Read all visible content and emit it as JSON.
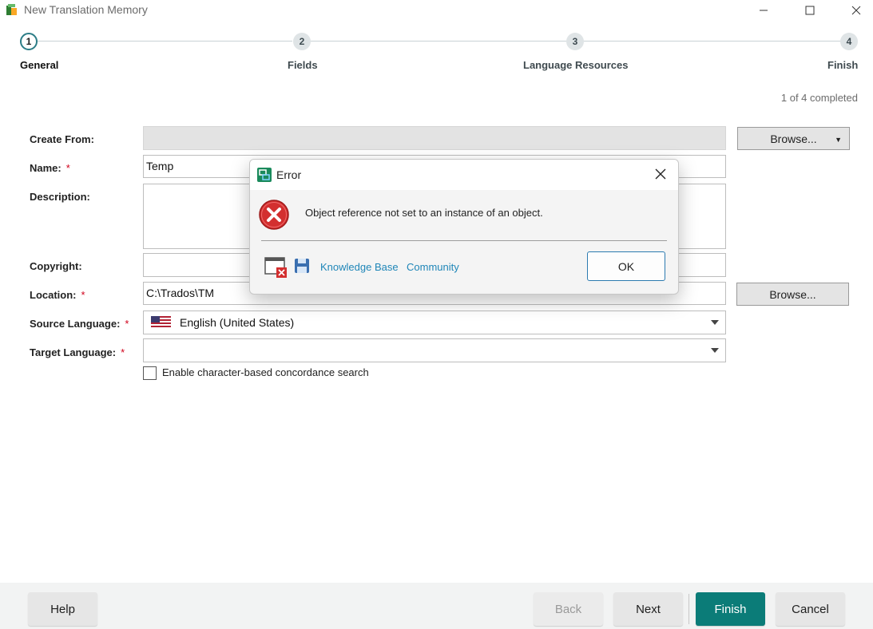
{
  "window": {
    "title": "New Translation Memory",
    "controls": [
      "minimize",
      "maximize",
      "close"
    ]
  },
  "steps": [
    {
      "number": "1",
      "label": "General",
      "active": true
    },
    {
      "number": "2",
      "label": "Fields",
      "active": false
    },
    {
      "number": "3",
      "label": "Language Resources",
      "active": false
    },
    {
      "number": "4",
      "label": "Finish",
      "active": false
    }
  ],
  "progress": {
    "text": "1 of 4 completed",
    "completed": 1,
    "total": 4
  },
  "form": {
    "create_from": {
      "label": "Create From:",
      "value": "",
      "browse": "Browse..."
    },
    "name": {
      "label": "Name:",
      "required": "*",
      "value": "Temp"
    },
    "description": {
      "label": "Description:",
      "value": ""
    },
    "copyright": {
      "label": "Copyright:",
      "value": ""
    },
    "location": {
      "label": "Location:",
      "required": "*",
      "value": "C:\\Trados\\TM",
      "browse": "Browse..."
    },
    "source_language": {
      "label": "Source Language:",
      "required": "*",
      "value": "English (United States)",
      "flag": "us-flag-icon"
    },
    "target_language": {
      "label": "Target Language:",
      "required": "*",
      "value": ""
    },
    "concordance": {
      "label": "Enable character-based concordance search",
      "checked": false
    }
  },
  "footer": {
    "help": "Help",
    "back": "Back",
    "next": "Next",
    "finish": "Finish",
    "cancel": "Cancel"
  },
  "dialog": {
    "title": "Error",
    "message": "Object reference not set to an instance of an object.",
    "links": [
      "Knowledge Base",
      "Community"
    ],
    "ok": "OK"
  },
  "colors": {
    "accent": "#0b7c78",
    "link": "#1f86b8",
    "required": "#d0021b",
    "error": "#d32f2f"
  }
}
